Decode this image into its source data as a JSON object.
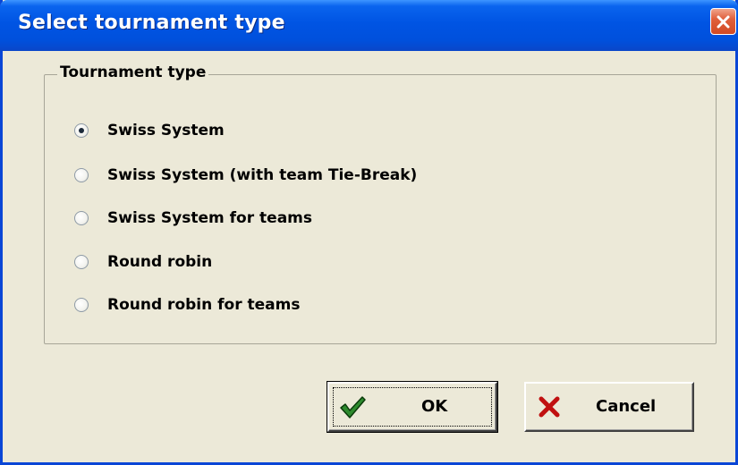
{
  "window": {
    "title": "Select tournament type"
  },
  "group": {
    "legend": "Tournament type",
    "options": [
      {
        "label": "Swiss System",
        "checked": true
      },
      {
        "label": "Swiss System (with team Tie-Break)",
        "checked": false
      },
      {
        "label": "Swiss System for teams",
        "checked": false
      },
      {
        "label": "Round robin",
        "checked": false
      },
      {
        "label": "Round robin for teams",
        "checked": false
      }
    ]
  },
  "buttons": {
    "ok": {
      "label": "OK",
      "icon": "checkmark-icon"
    },
    "cancel": {
      "label": "Cancel",
      "icon": "x-icon"
    }
  },
  "colors": {
    "titlebar": "#0054e3",
    "dialog_bg": "#ece9d8",
    "close_button": "#d24a24",
    "ok_check": "#2e8b2e",
    "cancel_x": "#c01010"
  }
}
